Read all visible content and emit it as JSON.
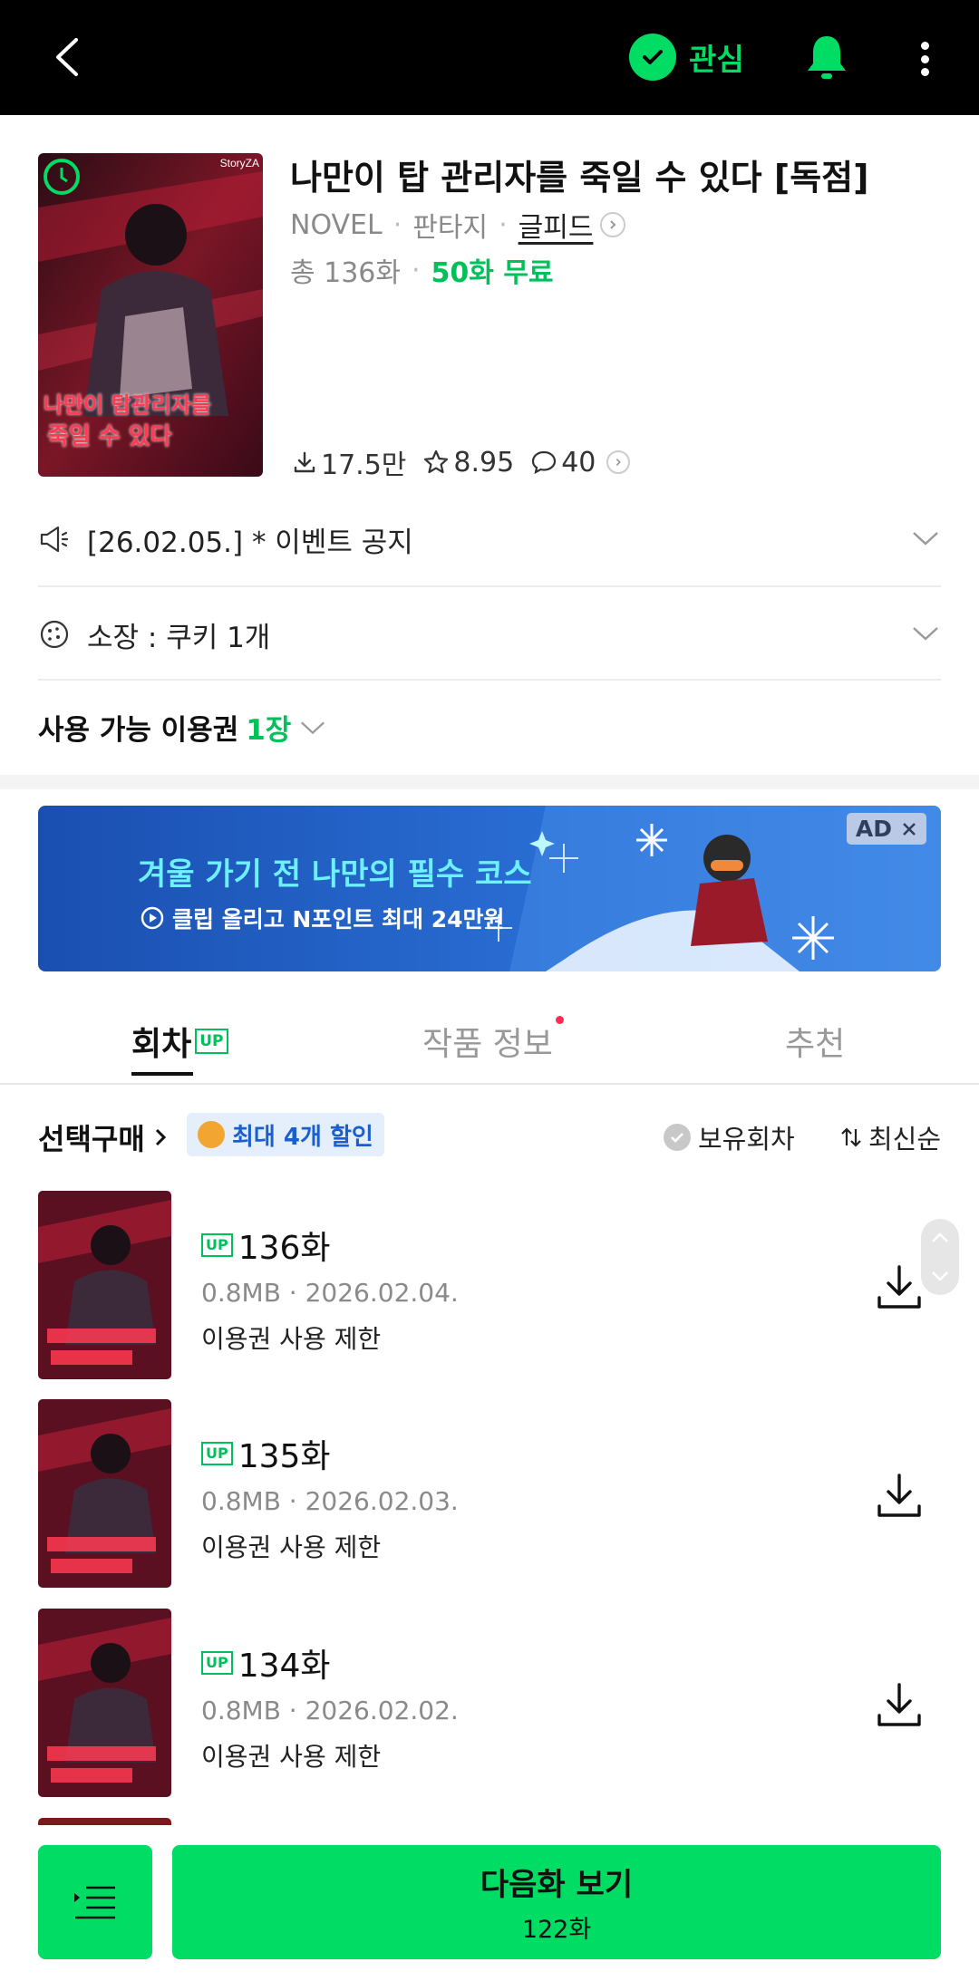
{
  "header": {
    "favorite_label": "관심"
  },
  "work": {
    "title": "나만이 탑 관리자를 죽일 수 있다 [독점]",
    "category": "NOVEL",
    "genre": "판타지",
    "author": "글피드",
    "total": "총 136화",
    "free": "50화 무료",
    "downloads": "17.5만",
    "rating": "8.95",
    "comments": "40",
    "cover_text_1": "나만이 탑관리자를",
    "cover_text_2": "죽일 수 있다",
    "cover_publisher": "StoryZA"
  },
  "notices": {
    "event": "[26.02.05.] * 이벤트 공지",
    "cookie": "소장 : 쿠키 1개",
    "voucher_label": "사용 가능 이용권",
    "voucher_count": "1장"
  },
  "ad": {
    "headline": "겨울 가기 전 나만의 필수 코스",
    "sub": "클립 올리고 N포인트 최대 24만원",
    "badge": "AD"
  },
  "tabs": {
    "episodes": "회차",
    "episodes_badge": "UP",
    "info": "작품 정보",
    "recommend": "추천"
  },
  "selection": {
    "purchase": "선택구매",
    "discount": "최대 4개 할인",
    "owned": "보유회차",
    "sort": "최신순"
  },
  "episodes": [
    {
      "badge": "UP",
      "title": "136화",
      "meta": "0.8MB · 2026.02.04.",
      "limit": "이용권 사용 제한"
    },
    {
      "badge": "UP",
      "title": "135화",
      "meta": "0.8MB · 2026.02.03.",
      "limit": "이용권 사용 제한"
    },
    {
      "badge": "UP",
      "title": "134화",
      "meta": "0.8MB · 2026.02.02.",
      "limit": "이용권 사용 제한"
    }
  ],
  "bottom": {
    "next_label": "다음화 보기",
    "next_episode": "122화"
  },
  "colors": {
    "brand_green": "#00dc64",
    "free_green": "#00c05a",
    "discount_blue": "#1b5fcf"
  }
}
